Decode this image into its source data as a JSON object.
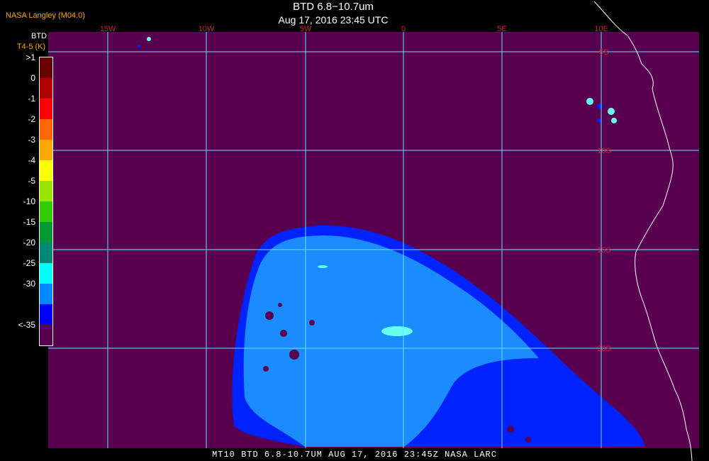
{
  "header": {
    "producer": "NASA Langley (M04.0)",
    "title": "BTD 6.8−10.7um",
    "timestamp": "Aug 17, 2016 23:45 UTC"
  },
  "legend": {
    "title": "BTD",
    "units": "T4-5 (K)",
    "classes": [
      {
        "label": ">1",
        "color": "#6b0000"
      },
      {
        "label": "0",
        "color": "#b00000"
      },
      {
        "label": "-1",
        "color": "#ff0000"
      },
      {
        "label": "-2",
        "color": "#ff6600"
      },
      {
        "label": "-3",
        "color": "#ffaa00"
      },
      {
        "label": "-4",
        "color": "#ffff00"
      },
      {
        "label": "-5",
        "color": "#99e600"
      },
      {
        "label": "-10",
        "color": "#33cc00"
      },
      {
        "label": "-15",
        "color": "#009933"
      },
      {
        "label": "-20",
        "color": "#008877"
      },
      {
        "label": "-25",
        "color": "#00ffff"
      },
      {
        "label": "-30",
        "color": "#0088ff"
      },
      {
        "label": "",
        "color": "#0000ff"
      },
      {
        "label": "<-35",
        "color": "#5a0050"
      }
    ]
  },
  "map": {
    "background_color": "#5a0050",
    "longitude_labels": [
      "15W",
      "10W",
      "5W",
      "0",
      "5E",
      "10E"
    ],
    "latitude_labels": [
      "5S",
      "10S",
      "15S",
      "20S"
    ],
    "grid_color": "#66e0ff",
    "label_color": "#cc2233",
    "coastline_color": "#ffffff",
    "cloud_colors": {
      "outer": "#0022ff",
      "inner": "#1a8cff",
      "core": "#66ffee"
    }
  },
  "footer": {
    "caption": "MT10   BTD 6.8-10.7UM    AUG 17, 2016 23:45Z    NASA LARC"
  }
}
